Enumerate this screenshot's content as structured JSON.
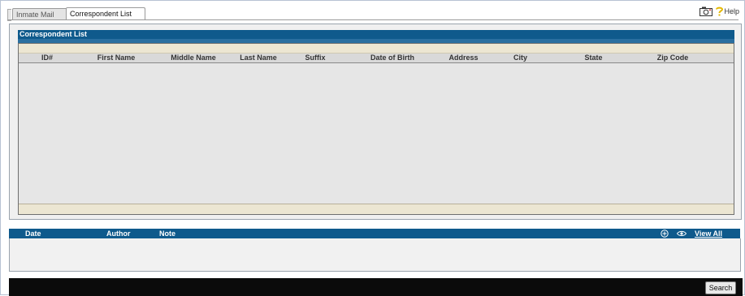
{
  "tabs": {
    "inmate_mail": "Inmate Mail",
    "correspondent_list": "Correspondent List"
  },
  "toolbar": {
    "help_label": "Help",
    "camera_icon": "camera-icon",
    "help_icon": "question-icon"
  },
  "correspondent_panel": {
    "title": "Correspondent List",
    "columns": [
      "ID#",
      "First Name",
      "Middle Name",
      "Last Name",
      "Suffix",
      "Date of Birth",
      "Address",
      "City",
      "State",
      "Zip Code"
    ]
  },
  "notes_panel": {
    "columns": [
      "Date",
      "Author",
      "Note"
    ],
    "view_all": "View All",
    "add_icon": "plus-circle-icon",
    "view_icon": "eye-icon"
  },
  "footer": {
    "search_label": "Search"
  },
  "colors": {
    "header_blue": "#0f5a8c",
    "band_beige": "#ece6d2",
    "footer_black": "#0b0b0b"
  }
}
